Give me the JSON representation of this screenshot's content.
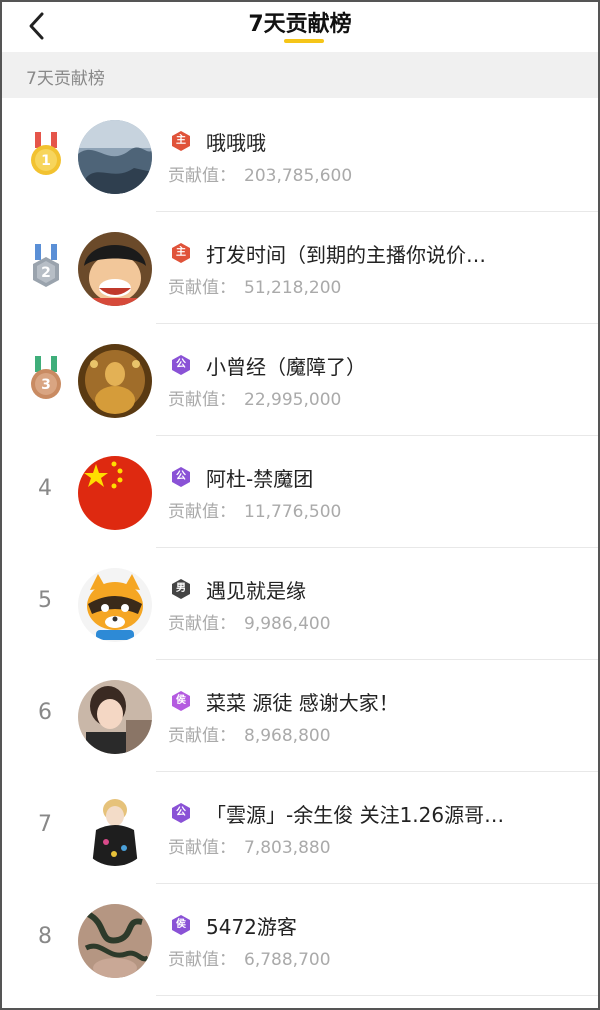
{
  "header": {
    "title": "7天贡献榜"
  },
  "section": {
    "label": "7天贡献榜"
  },
  "colors": {
    "accent": "#f5c518",
    "badge_red": "#e0533a",
    "badge_purple": "#8a52d6",
    "badge_violet": "#b45be0",
    "badge_dark": "#444444"
  },
  "list": [
    {
      "rank": "1",
      "medal": "gold",
      "badge": "主",
      "badge_color": "#e0533a",
      "name": "哦哦哦",
      "contrib_label": "贡献值：",
      "contrib_value": "203,785,600",
      "avatar": "landscape"
    },
    {
      "rank": "2",
      "medal": "silver",
      "badge": "主",
      "badge_color": "#e0533a",
      "name": "打发时间（到期的主播你说价…",
      "contrib_label": "贡献值：",
      "contrib_value": "51,218,200",
      "avatar": "cartoon"
    },
    {
      "rank": "3",
      "medal": "bronze",
      "badge": "公",
      "badge_color": "#8a52d6",
      "name": "小曾经（魔障了）",
      "contrib_label": "贡献值：",
      "contrib_value": "22,995,000",
      "avatar": "temple"
    },
    {
      "rank": "4",
      "medal": "",
      "badge": "公",
      "badge_color": "#8a52d6",
      "name": "阿杜-禁魔团",
      "contrib_label": "贡献值：",
      "contrib_value": "11,776,500",
      "avatar": "flag"
    },
    {
      "rank": "5",
      "medal": "",
      "badge": "男",
      "badge_color": "#444444",
      "name": "遇见就是缘",
      "contrib_label": "贡献值：",
      "contrib_value": "9,986,400",
      "avatar": "raccoon"
    },
    {
      "rank": "6",
      "medal": "",
      "badge": "侯",
      "badge_color": "#b45be0",
      "name": "菜菜  源徒  感谢大家！",
      "contrib_label": "贡献值：",
      "contrib_value": "8,968,800",
      "avatar": "girl"
    },
    {
      "rank": "7",
      "medal": "",
      "badge": "公",
      "badge_color": "#8a52d6",
      "name": "「雲源」-余生俊 关注1.26源哥…",
      "contrib_label": "贡献值：",
      "contrib_value": "7,803,880",
      "avatar": "sketch"
    },
    {
      "rank": "8",
      "medal": "",
      "badge": "侯",
      "badge_color": "#8a52d6",
      "name": "5472游客",
      "contrib_label": "贡献值：",
      "contrib_value": "6,788,700",
      "avatar": "tattoo"
    }
  ]
}
